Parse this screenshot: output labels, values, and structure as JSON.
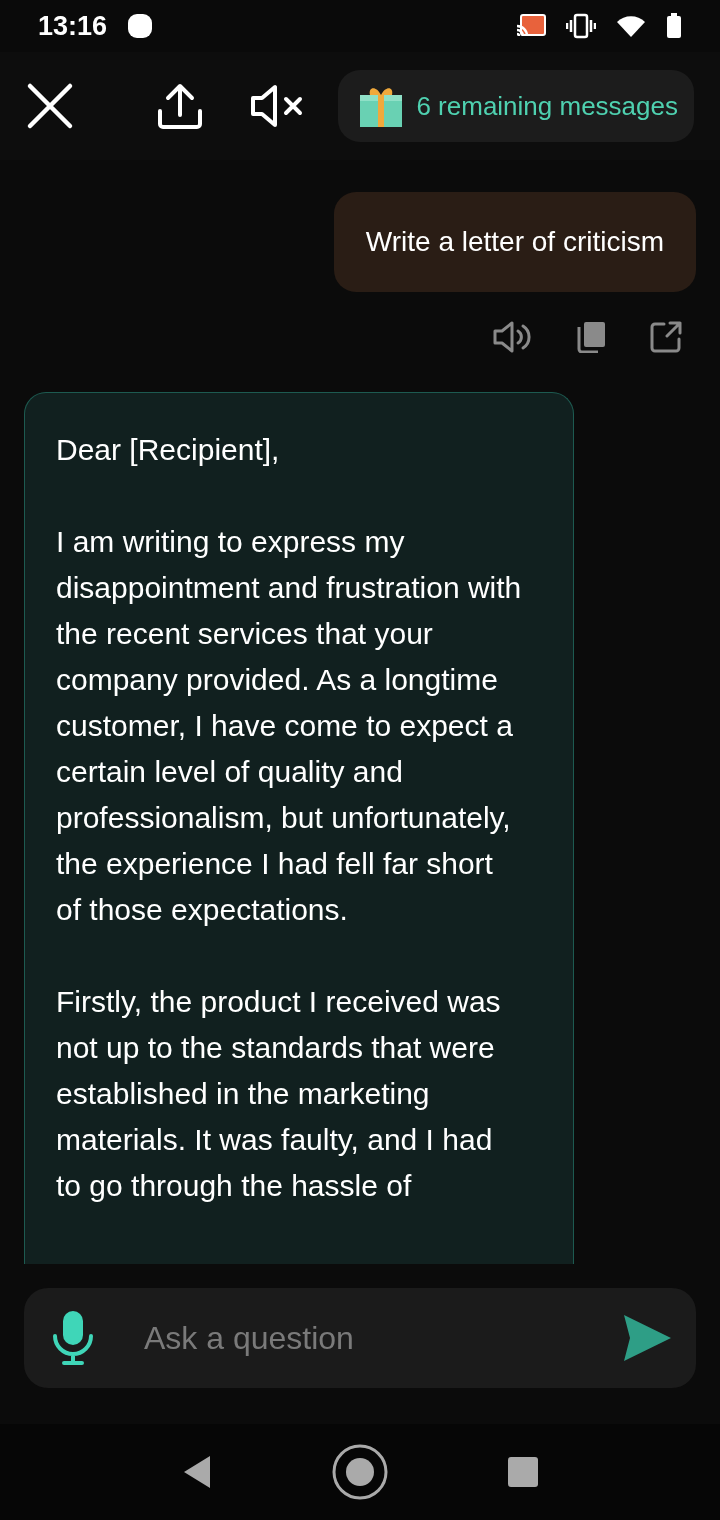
{
  "status_bar": {
    "time": "13:16"
  },
  "header": {
    "credits": "6 remaining messages"
  },
  "messages": [
    {
      "kind": "user",
      "paragraphs": [
        "Write a letter of criticism"
      ]
    },
    {
      "kind": "bot",
      "paragraphs": [
        "Dear [Recipient],",
        "I am writing to express my disappointment and frustration with the recent services that your company provided. As a longtime customer, I have come to expect a certain level of quality and professionalism, but unfortunately, the experience I had fell far short of those expectations.",
        "Firstly, the product I received was not up to the standards that were established in the marketing materials. It was faulty, and I had to go through the hassle of"
      ]
    }
  ],
  "composer": {
    "placeholder": "Ask a question"
  }
}
